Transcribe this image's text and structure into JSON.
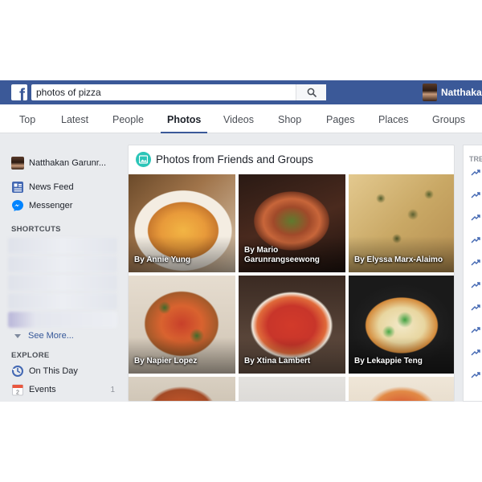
{
  "header": {
    "brand_logo_letter": "f",
    "search_value": "photos of pizza",
    "profile_name": "Natthakan",
    "brand_color": "#3b5998"
  },
  "tabs": [
    "Top",
    "Latest",
    "People",
    "Photos",
    "Videos",
    "Shop",
    "Pages",
    "Places",
    "Groups"
  ],
  "active_tab": "Photos",
  "sidebar": {
    "profile_name": "Natthakan Garunr...",
    "items": [
      {
        "label": "News Feed",
        "icon": "news-feed-icon"
      },
      {
        "label": "Messenger",
        "icon": "messenger-icon"
      }
    ],
    "shortcuts_heading": "SHORTCUTS",
    "see_more": "See More...",
    "explore_heading": "EXPLORE",
    "explore_items": [
      {
        "label": "On This Day",
        "icon": "on-this-day-icon"
      },
      {
        "label": "Events",
        "icon": "events-icon",
        "count": "1"
      }
    ]
  },
  "main": {
    "section_title": "Photos from Friends and Groups",
    "photos": [
      {
        "caption": "By Annie Yung"
      },
      {
        "caption": "By Mario Garunrangseewong"
      },
      {
        "caption": "By Elyssa Marx-Alaimo"
      },
      {
        "caption": "By Napier Lopez"
      },
      {
        "caption": "By Xtina Lambert"
      },
      {
        "caption": "By Lekappie Teng"
      },
      {
        "caption": ""
      },
      {
        "caption": ""
      },
      {
        "caption": ""
      }
    ]
  },
  "right_rail": {
    "heading": "TRE"
  },
  "colors": {
    "accent": "#3b5998",
    "link": "#365899",
    "photo_badge": "#2bc5b8"
  }
}
